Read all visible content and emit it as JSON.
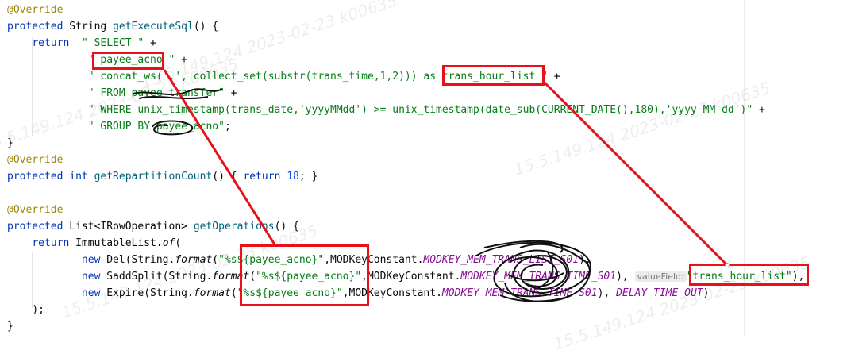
{
  "watermark_text": "15.5.149.124 2023-02-23 k00635",
  "code": {
    "l1": {
      "ann": "@Override"
    },
    "l2": {
      "kw": "protected",
      "type": " String ",
      "fn": "getExecuteSql",
      "rest": "() {"
    },
    "l3": {
      "kw": "return",
      "s": "\" SELECT \"",
      "op": " +"
    },
    "l4": {
      "s": "\" payee_acno \"",
      "op": " +"
    },
    "l5": {
      "s": "\" concat_ws(',', collect_set(substr(trans_time,1,2))) as trans_hour_list \"",
      "op": " +"
    },
    "l6": {
      "s": "\" FROM payee_transfer\"",
      "op": " +"
    },
    "l7": {
      "s": "\" WHERE unix_timestamp(trans_date,'yyyyMMdd') >= unix_timestamp(date_sub(CURRENT_DATE(),180),'yyyy-MM-dd')\"",
      "op": " +"
    },
    "l8": {
      "s": "\" GROUP BY payee_acno\"",
      "op": ";"
    },
    "l9": {
      "p": "}"
    },
    "l10": {
      "ann": "@Override"
    },
    "l11": {
      "kw": "protected int",
      "fn": "getRepartitionCount",
      "a": "() ",
      "b": "{ ",
      "kw2": "return ",
      "num": "18",
      "c": "; ",
      "d": "}"
    },
    "l13": {
      "ann": "@Override"
    },
    "l14": {
      "kw": "protected",
      "type": " List<IRowOperation> ",
      "fn": "getOperations",
      "rest": "() {"
    },
    "l15": {
      "kw": "return",
      "a": " ImmutableList.",
      "it": "of",
      "b": "("
    },
    "l16": {
      "kw": "new",
      "a": " Del(String.",
      "it": "format",
      "b": "(",
      "s": "\"%s${payee_acno}\"",
      "c": ",MODKeyConstant.",
      "const": "MODKEY_MEM_TRANS_LIST_S01",
      "d": "),"
    },
    "l17": {
      "kw": "new",
      "a": " SaddSplit(String.",
      "it": "format",
      "b": "(",
      "s": "\"%s${payee_acno}\"",
      "c": ",MODKeyConstant.",
      "const": "MODKEY_MEM_TRANS_TIME_S01",
      "d": "), ",
      "hint": "valueField:",
      "s2": "\"trans_hour_list\"",
      "e": "),"
    },
    "l18": {
      "kw": "new",
      "a": " Expire(String.",
      "it": "format",
      "b": "(",
      "s": "\"%s${payee_acno}\"",
      "c": ",MODKeyConstant.",
      "const": "MODKEY_MEM_TRANS_TIME_S01",
      "d": "), ",
      "const2": "DELAY_TIME_OUT",
      "e": ")"
    },
    "l19": {
      "p": ");"
    },
    "l20": {
      "p": "}"
    }
  }
}
